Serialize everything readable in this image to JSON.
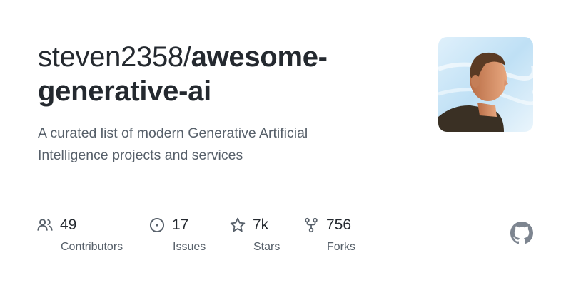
{
  "repo": {
    "owner": "steven2358/",
    "name_part1": "awesome-",
    "name_part2": "generative-ai",
    "description": "A curated list of modern Generative Artificial Intelligence projects and services"
  },
  "stats": [
    {
      "icon": "people-icon",
      "value": "49",
      "label": "Contributors"
    },
    {
      "icon": "issue-icon",
      "value": "17",
      "label": "Issues"
    },
    {
      "icon": "star-icon",
      "value": "7k",
      "label": "Stars"
    },
    {
      "icon": "fork-icon",
      "value": "756",
      "label": "Forks"
    }
  ],
  "colors": {
    "title": "#24292f",
    "muted": "#57606a",
    "icon": "#57606a",
    "logo": "#7d8590"
  }
}
